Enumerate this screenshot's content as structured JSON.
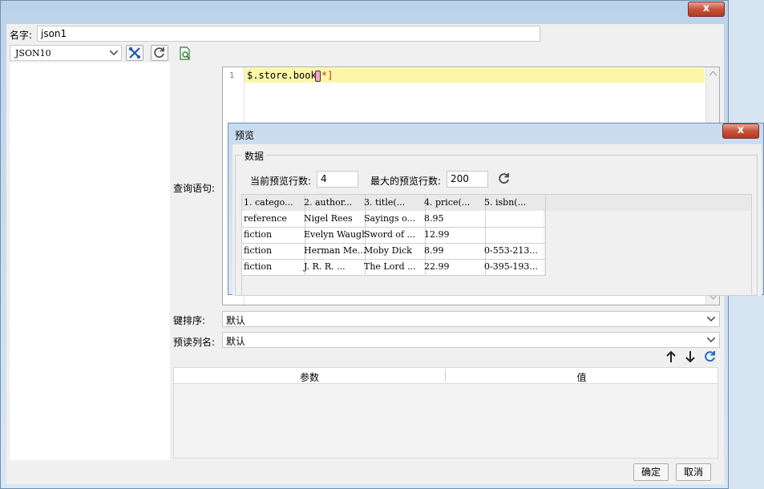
{
  "main": {
    "name_label": "名字:",
    "name_value": "json1",
    "datasource_value": "JSON10",
    "query_label": "查询语句:",
    "editor": {
      "line_number": "1",
      "code": "$.store.book",
      "code_suffix": "*]"
    },
    "key_sort_label": "键排序:",
    "key_sort_value": "默认",
    "preview_col_label": "预读列名:",
    "preview_col_value": "默认",
    "params_table": {
      "headers": [
        "参数",
        "值"
      ]
    },
    "ok_button": "确定",
    "cancel_button": "取消",
    "close_glyph": "x"
  },
  "preview": {
    "title": "预览",
    "group_label": "数据",
    "current_rows_label": "当前预览行数:",
    "current_rows_value": "4",
    "max_rows_label": "最大的预览行数:",
    "max_rows_value": "200",
    "close_glyph": "x",
    "grid": {
      "headers": [
        "1. catego...",
        "2. author...",
        "3. title(...",
        "4. price(...",
        "5. isbn(..."
      ],
      "rows": [
        [
          "reference",
          "Nigel Rees",
          "Sayings o...",
          "8.95",
          ""
        ],
        [
          "fiction",
          "Evelyn Waugh",
          "Sword of ...",
          "12.99",
          ""
        ],
        [
          "fiction",
          "Herman Me...",
          "Moby Dick",
          "8.99",
          "0-553-213..."
        ],
        [
          "fiction",
          "J. R. R. ...",
          "The Lord ...",
          "22.99",
          "0-395-193..."
        ]
      ]
    }
  },
  "icons": {
    "settings": "tools-icon",
    "refresh": "refresh-icon",
    "preview": "preview-doc-icon",
    "up": "arrow-up-icon",
    "down": "arrow-down-icon"
  }
}
